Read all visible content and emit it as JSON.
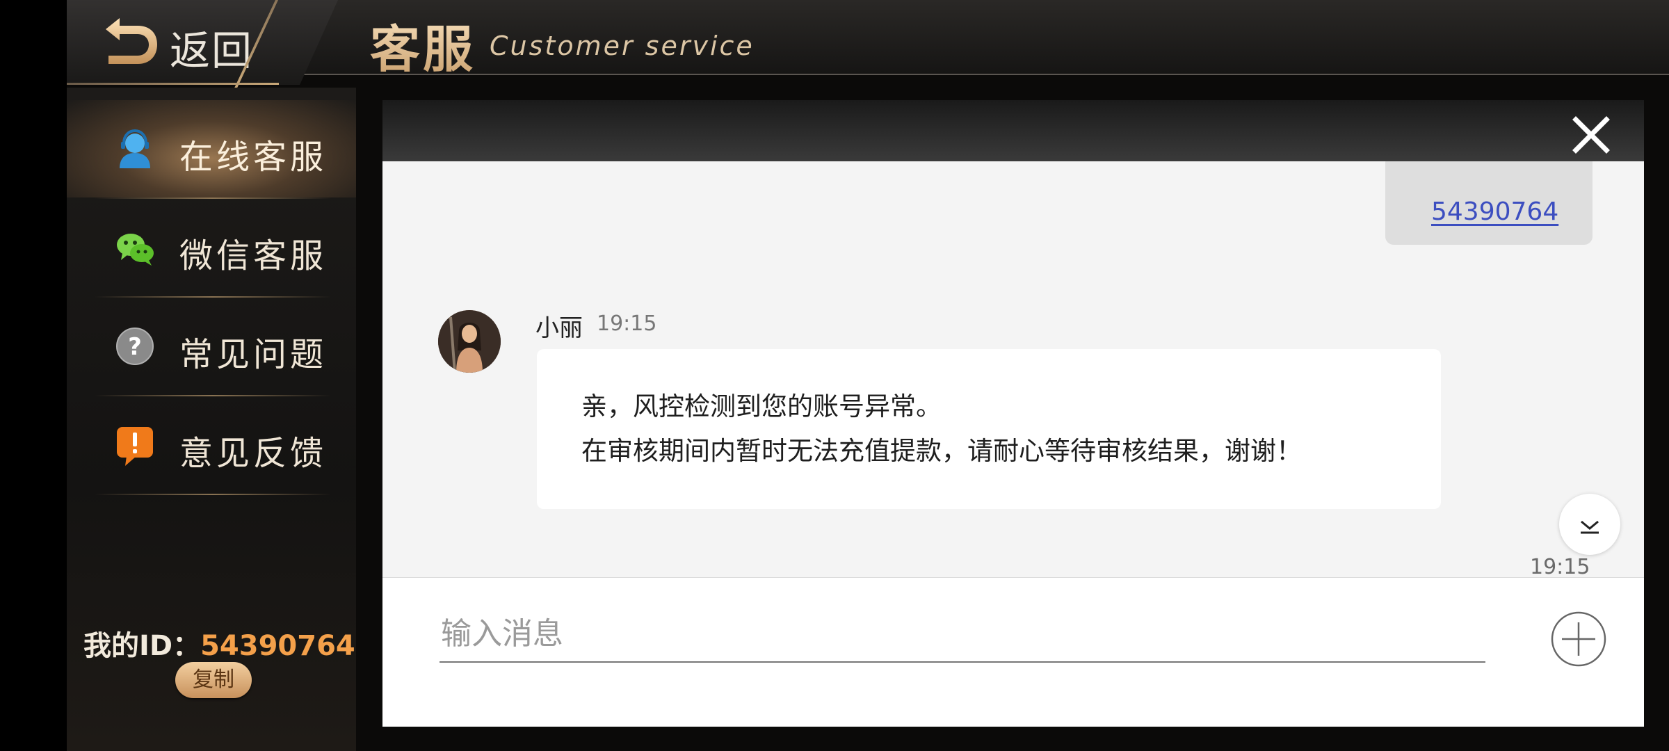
{
  "header": {
    "back_label": "返回",
    "title_cn": "客服",
    "title_en": "Customer service"
  },
  "sidebar": {
    "items": [
      {
        "label": "在线客服",
        "icon": "agent-icon",
        "active": true
      },
      {
        "label": "微信客服",
        "icon": "wechat-icon",
        "active": false
      },
      {
        "label": "常见问题",
        "icon": "question-icon",
        "active": false
      },
      {
        "label": "意见反馈",
        "icon": "feedback-icon",
        "active": false
      }
    ],
    "id_label": "我的ID：",
    "id_value": "54390764",
    "copy_label": "复制"
  },
  "chat": {
    "sent_message": "54390764",
    "agent_name": "小丽",
    "agent_time": "19:15",
    "agent_lines": [
      "亲，风控检测到您的账号异常。",
      "在审核期间内暂时无法充值提款，请耐心等待审核结果，谢谢！"
    ],
    "bottom_time": "19:15",
    "input_placeholder": "输入消息"
  },
  "colors": {
    "accent_gold": "#e8c898",
    "id_orange": "#f4a04a",
    "link_blue": "#3c4ec0"
  }
}
